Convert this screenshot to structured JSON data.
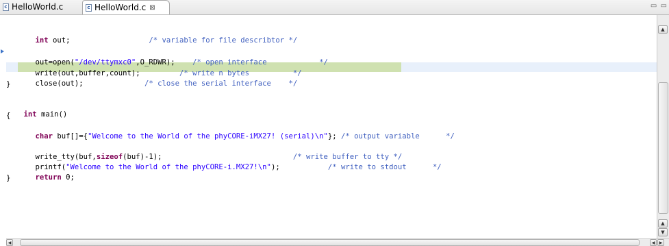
{
  "tabs": [
    {
      "label": "HelloWorld.c",
      "icon": "c-file-icon",
      "active": false
    },
    {
      "label": "HelloWorld.c",
      "icon": "c-file-icon",
      "active": true,
      "close": "⊠"
    }
  ],
  "window_controls": "▭ ▭",
  "colors": {
    "keyword": "#7f0055",
    "string": "#2a00ff",
    "comment": "#3f5fbf",
    "current_line": "#e8f0fb",
    "selection_highlight": "#cfe1b0"
  },
  "code": {
    "line1": {
      "kw": "int",
      "rest": " out;",
      "pad": "                  ",
      "cmt": "/* variable for file describtor */"
    },
    "line3": {
      "a": "out=open(",
      "str": "\"/dev/ttymxc0\"",
      "b": ",O_RDWR);    ",
      "cmt": "/* open interface            */"
    },
    "line4": {
      "a": "write(out,buffer,count);         ",
      "cmt": "/* write n bytes          */"
    },
    "line5": {
      "a": "close(out);              ",
      "cmt": "/* close the serial interface    */"
    },
    "line6": "}",
    "line8": {
      "kw": "int",
      "rest": " main()"
    },
    "line9": "{",
    "line10": {
      "kw": "char",
      "a": " buf[]={",
      "str": "\"Welcome to the World of the phyCORE-iMX27! (serial)\\n\"",
      "b": "}; ",
      "cmt": "/* output variable      */"
    },
    "line12": {
      "a": "write_tty(buf,",
      "kw": "sizeof",
      "b": "(buf)-1);                              ",
      "cmt": "/* write buffer to tty */"
    },
    "line13": {
      "a": "printf(",
      "str": "\"Welcome to the World of the phyCORE-i.MX27!\\n\"",
      "b": ");           ",
      "cmt": "/* write to stdout      */"
    },
    "line14": {
      "kw": "return",
      "rest": " 0;"
    },
    "line15": "}"
  }
}
